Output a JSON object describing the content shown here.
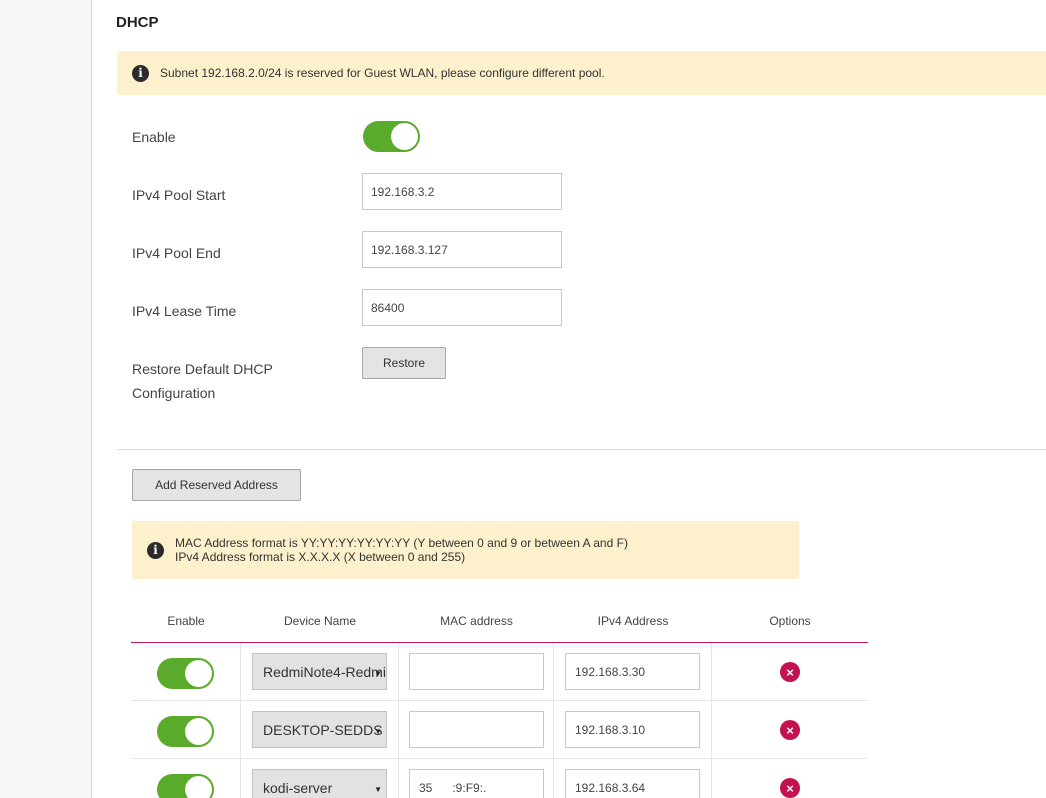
{
  "section_title": "DHCP",
  "notice_top": "Subnet 192.168.2.0/24 is reserved for Guest WLAN, please configure different pool.",
  "form": {
    "enable_label": "Enable",
    "enable_on": true,
    "pool_start_label": "IPv4 Pool Start",
    "pool_start_value": "192.168.3.2",
    "pool_end_label": "IPv4 Pool End",
    "pool_end_value": "192.168.3.127",
    "lease_label": "IPv4 Lease Time",
    "lease_value": "86400",
    "restore_label_line1": "Restore Default DHCP",
    "restore_label_line2": "Configuration",
    "restore_button": "Restore"
  },
  "add_reserved_button": "Add Reserved Address",
  "notice_mac": {
    "line1": "MAC Address format is YY:YY:YY:YY:YY:YY (Y between 0 and 9 or between A and F)",
    "line2": "IPv4 Address format is X.X.X.X (X between 0 and 255)"
  },
  "table": {
    "headers": [
      "Enable",
      "Device Name",
      "MAC address",
      "IPv4 Address",
      "Options"
    ],
    "rows": [
      {
        "enabled": true,
        "device": "RedmiNote4-Redmi",
        "mac": "",
        "ip": "192.168.3.30"
      },
      {
        "enabled": true,
        "device": "DESKTOP-SEDDS",
        "mac": "",
        "ip": "192.168.3.10"
      },
      {
        "enabled": true,
        "device": "kodi-server",
        "mac": "35      :9:F9:.",
        "ip": "192.168.3.64"
      }
    ]
  },
  "icons": {
    "info": "info-icon",
    "delete": "delete-icon",
    "dropdown": "chevron-down-icon"
  },
  "colors": {
    "toggle_on": "#5aaa2b",
    "notice_bg": "#fcf1cc",
    "accent": "#c2185b",
    "delete": "#c4114f"
  }
}
